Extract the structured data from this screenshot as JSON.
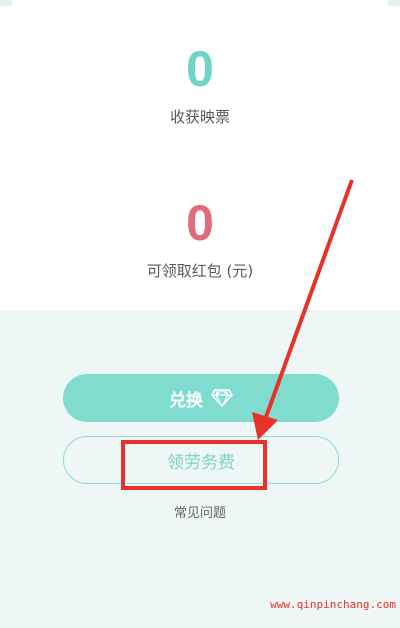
{
  "stats": {
    "harvest": {
      "value": "0",
      "label": "收获映票"
    },
    "redpacket": {
      "value": "0",
      "label": "可领取红包 (元)"
    }
  },
  "actions": {
    "exchange_label": "兑换",
    "service_fee_label": "领劳务费",
    "faq_label": "常见问题"
  },
  "icons": {
    "exchange_icon": "diamond-icon"
  },
  "colors": {
    "teal": "#6fd3c6",
    "pink_red": "#e06b7d",
    "button_teal": "#7fdccf",
    "annotation_red": "#e7322a"
  },
  "watermark": "www.qinpinchang.com"
}
